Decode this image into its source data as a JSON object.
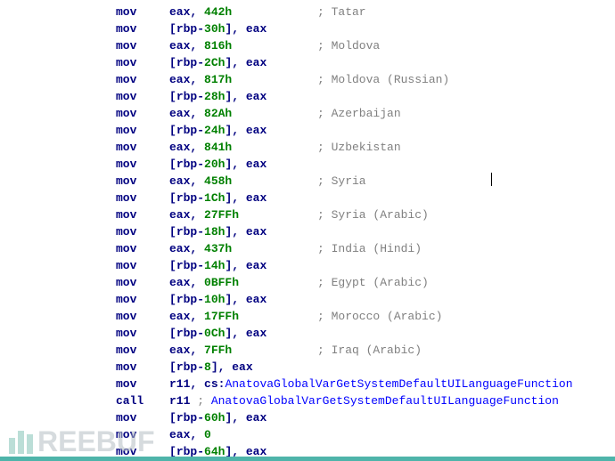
{
  "watermark": "REEBUF",
  "asm": {
    "lines": [
      {
        "type": "mov_imm",
        "dst": "eax",
        "imm": "442h",
        "cmt": "; Tatar"
      },
      {
        "type": "mov_store",
        "mem_reg": "rbp",
        "off": "30h",
        "src": "eax"
      },
      {
        "type": "mov_imm",
        "dst": "eax",
        "imm": "816h",
        "cmt": "; Moldova"
      },
      {
        "type": "mov_store",
        "mem_reg": "rbp",
        "off": "2Ch",
        "src": "eax"
      },
      {
        "type": "mov_imm",
        "dst": "eax",
        "imm": "817h",
        "cmt": "; Moldova (Russian)"
      },
      {
        "type": "mov_store",
        "mem_reg": "rbp",
        "off": "28h",
        "src": "eax"
      },
      {
        "type": "mov_imm",
        "dst": "eax",
        "imm": "82Ah",
        "cmt": "; Azerbaijan"
      },
      {
        "type": "mov_store",
        "mem_reg": "rbp",
        "off": "24h",
        "src": "eax"
      },
      {
        "type": "mov_imm",
        "dst": "eax",
        "imm": "841h",
        "cmt": "; Uzbekistan"
      },
      {
        "type": "mov_store",
        "mem_reg": "rbp",
        "off": "20h",
        "src": "eax"
      },
      {
        "type": "mov_imm",
        "dst": "eax",
        "imm": "458h",
        "cmt": "; Syria",
        "cursor_after": true
      },
      {
        "type": "mov_store",
        "mem_reg": "rbp",
        "off": "1Ch",
        "src": "eax"
      },
      {
        "type": "mov_imm",
        "dst": "eax",
        "imm": "27FFh",
        "cmt": "; Syria (Arabic)"
      },
      {
        "type": "mov_store",
        "mem_reg": "rbp",
        "off": "18h",
        "src": "eax"
      },
      {
        "type": "mov_imm",
        "dst": "eax",
        "imm": "437h",
        "cmt": "; India (Hindi)"
      },
      {
        "type": "mov_store",
        "mem_reg": "rbp",
        "off": "14h",
        "src": "eax"
      },
      {
        "type": "mov_imm",
        "dst": "eax",
        "imm": "0BFFh",
        "cmt": "; Egypt (Arabic)"
      },
      {
        "type": "mov_store",
        "mem_reg": "rbp",
        "off": "10h",
        "src": "eax"
      },
      {
        "type": "mov_imm",
        "dst": "eax",
        "imm": "17FFh",
        "cmt": "; Morocco (Arabic)"
      },
      {
        "type": "mov_store",
        "mem_reg": "rbp",
        "off": "0Ch",
        "src": "eax"
      },
      {
        "type": "mov_imm",
        "dst": "eax",
        "imm": "7FFh",
        "cmt": "; Iraq (Arabic)"
      },
      {
        "type": "mov_store_noh",
        "mem_reg": "rbp",
        "off": "8",
        "src": "eax"
      },
      {
        "type": "mov_sym",
        "dst": "r11",
        "seg": "cs",
        "sym": "AnatovaGlobalVarGetSystemDefaultUILanguageFunction"
      },
      {
        "type": "call_sym",
        "dst": "r11",
        "cmt_sym": "AnatovaGlobalVarGetSystemDefaultUILanguageFunction"
      },
      {
        "type": "mov_store",
        "mem_reg": "rbp",
        "off": "60h",
        "src": "eax"
      },
      {
        "type": "mov_imm0",
        "dst": "eax",
        "imm": "0"
      },
      {
        "type": "mov_store",
        "mem_reg": "rbp",
        "off": "64h",
        "src": "eax"
      }
    ]
  }
}
